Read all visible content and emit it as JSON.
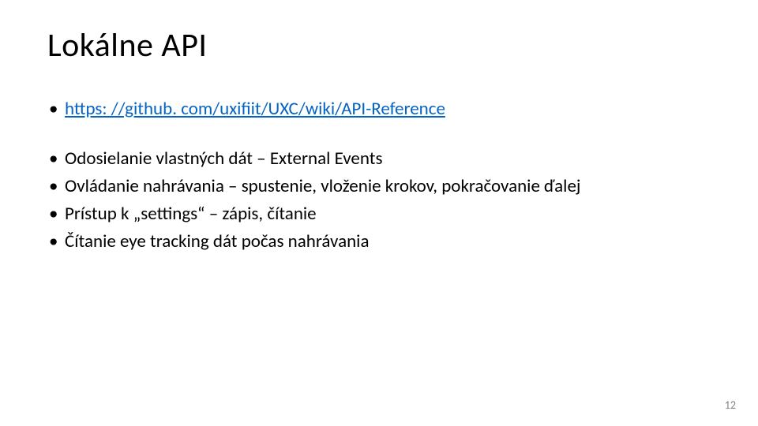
{
  "title": "Lokálne API",
  "link": {
    "text": "https: //github. com/uxifiit/UXC/wiki/API-Reference",
    "href": "#"
  },
  "bullets": [
    "Odosielanie vlastných dát – External Events",
    "Ovládanie nahrávania – spustenie, vloženie krokov, pokračovanie ďalej",
    "Prístup k „settings“ – zápis, čítanie",
    "Čítanie eye tracking dát počas nahrávania"
  ],
  "page_number": "12"
}
